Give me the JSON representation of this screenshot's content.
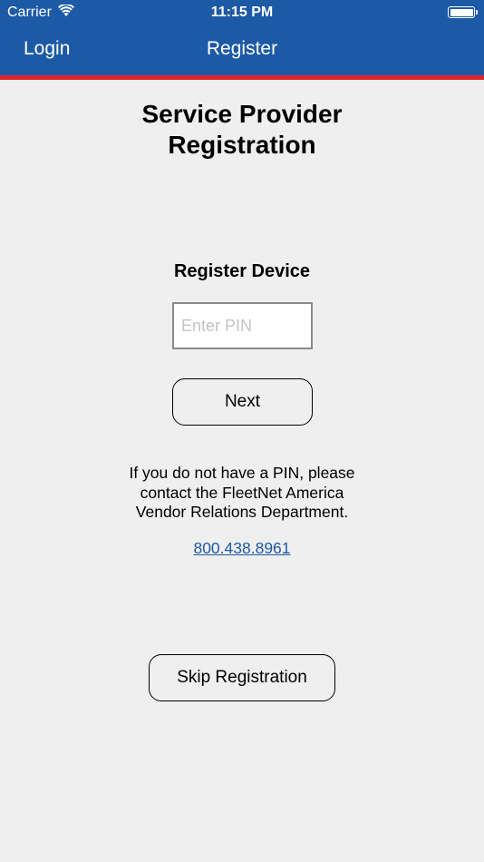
{
  "status_bar": {
    "carrier": "Carrier",
    "time": "11:15 PM"
  },
  "nav": {
    "back_label": "Login",
    "title": "Register"
  },
  "page": {
    "title_line1": "Service Provider",
    "title_line2": "Registration",
    "section_title": "Register Device",
    "pin_placeholder": "Enter PIN",
    "next_label": "Next",
    "info_line1": "If you do not have a PIN, please",
    "info_line2": "contact the FleetNet America",
    "info_line3": "Vendor Relations Department.",
    "phone": "800.438.8961",
    "skip_label": "Skip Registration"
  },
  "colors": {
    "header_bg": "#1d5aa6",
    "accent_stripe": "#e0242e",
    "page_bg": "#efefef",
    "link": "#1d5aa6"
  }
}
